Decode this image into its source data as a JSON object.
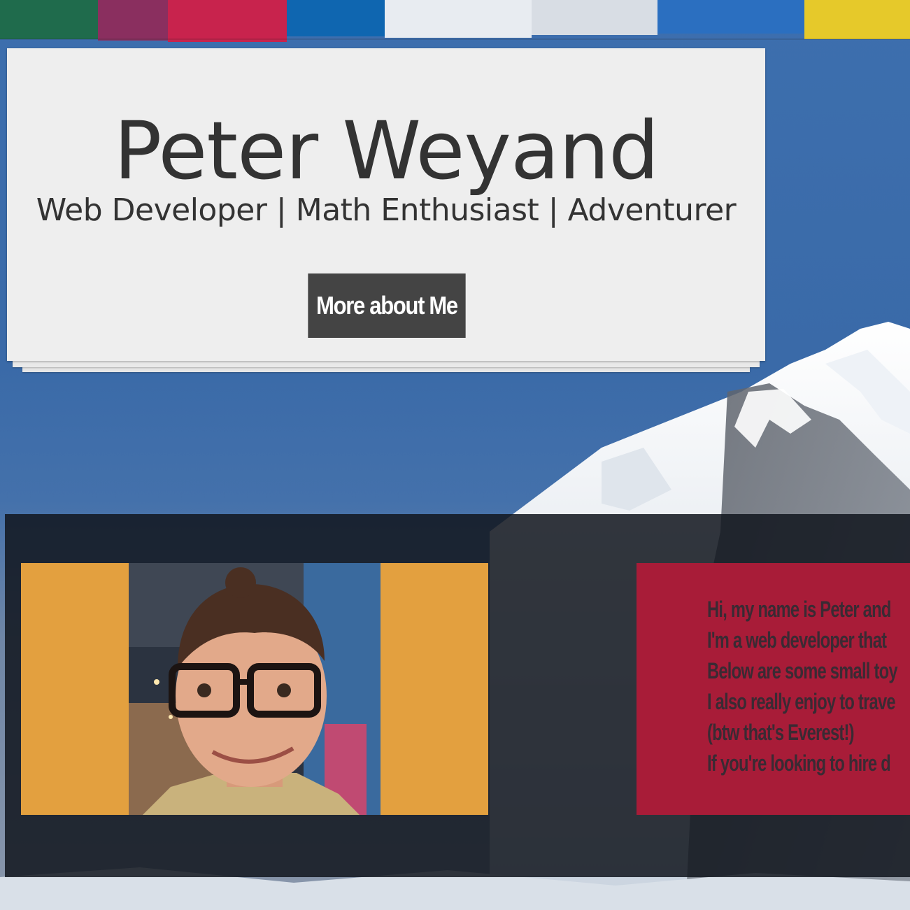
{
  "header": {
    "name": "Peter Weyand",
    "tagline": "Web Developer | Math Enthusiast | Adventurer",
    "more_button_label": "More about Me"
  },
  "about": {
    "bio_lines": [
      "Hi, my name is Peter and",
      "I'm a web developer that",
      "Below are some small toy",
      "I also really enjoy to trave",
      "(btw that's Everest!)",
      "If you're looking to hire d"
    ]
  },
  "colors": {
    "sky": "#3d6fae",
    "card": "#eeeeee",
    "text_dark": "#333333",
    "button": "#444444",
    "band": "#11161e",
    "photo_frame": "#e3a03f",
    "bio_box": "#a81c38"
  }
}
